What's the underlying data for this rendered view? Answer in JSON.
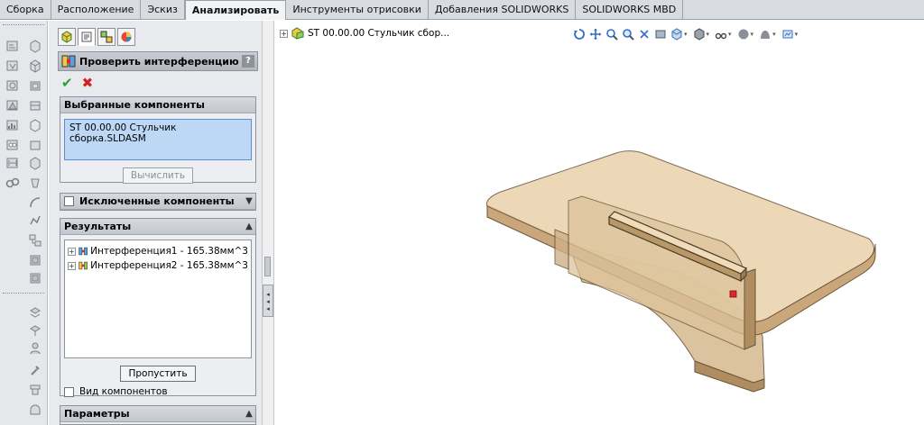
{
  "tabs": [
    {
      "label": "Сборка"
    },
    {
      "label": "Расположение"
    },
    {
      "label": "Эскиз"
    },
    {
      "label": "Анализировать",
      "active": true
    },
    {
      "label": "Инструменты отрисовки"
    },
    {
      "label": "Добавления SOLIDWORKS"
    },
    {
      "label": "SOLIDWORKS MBD"
    }
  ],
  "property_manager": {
    "title": "Проверить интерференцию компон...",
    "help": "?",
    "ok_symbol": "✔",
    "cancel_symbol": "✖",
    "selected_components": {
      "header": "Выбранные компоненты",
      "item": "ST 00.00.00 Стульчик сборка.SLDASM",
      "calculate_label": "Вычислить"
    },
    "excluded_components": {
      "header": "Исключенные компоненты"
    },
    "results": {
      "header": "Результаты",
      "items": [
        {
          "label": "Интерференция1 - 165.38мм^3"
        },
        {
          "label": "Интерференция2 - 165.38мм^3"
        }
      ],
      "ignore_label": "Пропустить",
      "component_view_label": "Вид компонентов"
    },
    "parameters": {
      "header": "Параметры"
    }
  },
  "viewport": {
    "tree_root": "ST 00.00.00 Стульчик сбор..."
  },
  "colors": {
    "wood_top": "#e9d2ab",
    "wood_side": "#c9a77a",
    "wood_edge": "#6a5338",
    "interference": "#e0262b",
    "accent_blue": "#5a8fd6"
  }
}
